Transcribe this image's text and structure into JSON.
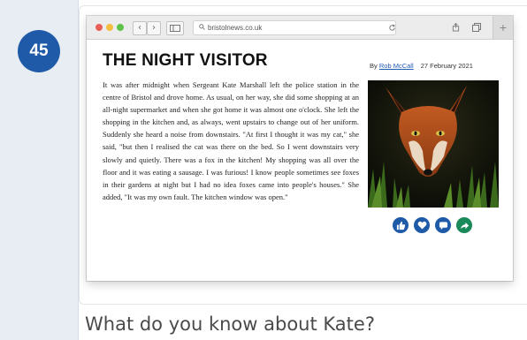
{
  "exercise": {
    "number": "45",
    "question": "What do you know about Kate?"
  },
  "browser": {
    "url": "bristolnews.co.uk",
    "back_glyph": "‹",
    "forward_glyph": "›",
    "traffic_light_colors": [
      "#ec5f57",
      "#f5bd3f",
      "#5dc248"
    ],
    "new_tab_glyph": "+"
  },
  "article": {
    "title": "THE NIGHT VISITOR",
    "byline_prefix": "By",
    "author": "Rob McCall",
    "date": "27 February 2021",
    "body": "It was after midnight when Sergeant Kate Marshall left the police station in the centre of Bristol and drove home. As usual, on her way, she did some shopping at an all-night supermarket and when she got home it was almost one o'clock. She left the shopping in the kitchen and, as always, went upstairs to change out of her uniform. Suddenly she heard a noise from downstairs. \"At first I thought it was my cat,\" she said, \"but then I realised the cat was there on the bed. So I went downstairs very slowly and quietly. There was a fox in the kitchen! My shopping was all over the floor and it was eating a sausage. I was furious! I know people sometimes see foxes in their gardens at night but I had no idea foxes came into people's houses.\" She added, \"It was my own fault. The kitchen window was open.\"",
    "image": "fox-photo",
    "share_icons": [
      "like-icon",
      "heart-icon",
      "comment-icon",
      "share-icon"
    ],
    "accent_color": "#1e5aa8"
  }
}
